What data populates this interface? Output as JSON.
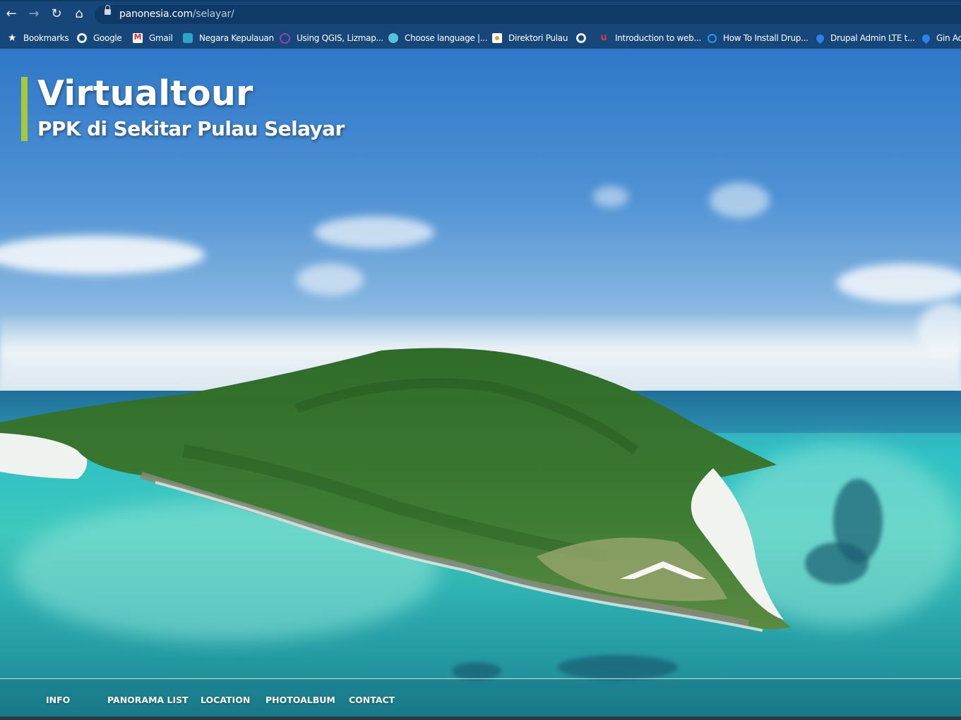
{
  "browser": {
    "url_host": "panonesia.com",
    "url_path": "/selayar/",
    "nav_icons": [
      "back-arrow-icon",
      "forward-arrow-icon",
      "reload-icon",
      "home-icon"
    ],
    "bookmarks": [
      {
        "label": "Bookmarks",
        "icon": "star-icon"
      },
      {
        "label": "Google",
        "icon": "globe-icon"
      },
      {
        "label": "Gmail",
        "icon": "gmail-icon"
      },
      {
        "label": "Negara Kepulauan",
        "icon": "site-icon"
      },
      {
        "label": "Using QGIS, Lizmap...",
        "icon": "site-icon"
      },
      {
        "label": "Choose language |...",
        "icon": "site-icon"
      },
      {
        "label": "Direktori Pulau",
        "icon": "site-icon"
      },
      {
        "label": "",
        "icon": "globe-icon"
      },
      {
        "label": "Introduction to web...",
        "icon": "site-icon"
      },
      {
        "label": "How To Install Drup...",
        "icon": "site-icon"
      },
      {
        "label": "Drupal Admin LTE t...",
        "icon": "drupal-icon"
      },
      {
        "label": "Gin Ac",
        "icon": "drupal-icon"
      }
    ]
  },
  "hero": {
    "title": "Virtualtour",
    "subtitle": "PPK di Sekitar Pulau Selayar"
  },
  "footer_nav": [
    "INFO",
    "PANORAMA LIST",
    "LOCATION",
    "PHOTOALBUM",
    "CONTACT"
  ],
  "colors": {
    "chrome": "#17477a",
    "accent_bar": "#a7c83b",
    "sea": "#2ec0c4",
    "island": "#2e6e2a"
  }
}
